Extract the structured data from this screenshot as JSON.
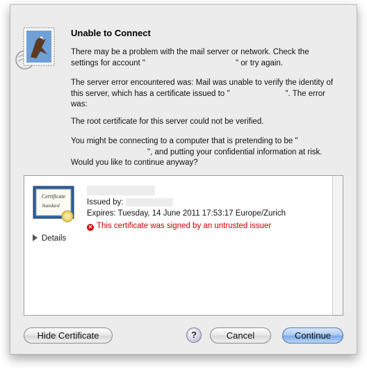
{
  "dialog": {
    "title": "Unable to Connect",
    "p1_a": "There may be a problem with the mail server or network. Check the settings for account \"",
    "p1_b": "\" or try again.",
    "p2_a": "The server error encountered was: Mail was unable to verify the identity of this server, which has a certificate issued to \"",
    "p2_b": "\". The error was:",
    "p3": "The root certificate for this server could not be verified.",
    "p4_a": "You might be connecting to a computer that is pretending to be \"",
    "p4_b": "\", and putting your confidential information at risk. Would you like to continue anyway?"
  },
  "certificate": {
    "icon_text_1": "Certificate",
    "icon_text_2": "Standard",
    "issued_by_label": "Issued by:",
    "expires": "Expires: Tuesday, 14 June 2011 17:53:17 Europe/Zurich",
    "error": "This certificate was signed by an untrusted issuer",
    "details_label": "Details"
  },
  "buttons": {
    "hide_certificate": "Hide Certificate",
    "help": "?",
    "cancel": "Cancel",
    "continue": "Continue"
  }
}
